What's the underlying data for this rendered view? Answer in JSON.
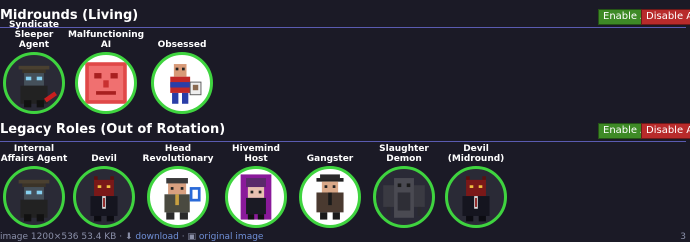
{
  "midrounds": {
    "title": "Midrounds (Living)",
    "enable_label": "Enable All",
    "disable_label": "Disable All",
    "roles": [
      {
        "label": "Syndicate\nSleeper Agent",
        "icon": "sleeper-agent-icon"
      },
      {
        "label": "Malfunctioning\nAI",
        "icon": "malf-ai-icon"
      },
      {
        "label": "Obsessed",
        "icon": "obsessed-icon"
      }
    ]
  },
  "legacy": {
    "title": "Legacy Roles (Out of Rotation)",
    "enable_label": "Enable All",
    "disable_label": "Disable All",
    "roles": [
      {
        "label": "Internal\nAffairs Agent",
        "icon": "internal-affairs-icon"
      },
      {
        "label": "Devil",
        "icon": "devil-icon"
      },
      {
        "label": "Head\nRevolutionary",
        "icon": "head-revolutionary-icon"
      },
      {
        "label": "Hivemind Host",
        "icon": "hivemind-host-icon"
      },
      {
        "label": "Gangster",
        "icon": "gangster-icon"
      },
      {
        "label": "Slaughter\nDemon",
        "icon": "slaughter-demon-icon"
      },
      {
        "label": "Devil\n(Midround)",
        "icon": "devil-midround-icon"
      }
    ]
  },
  "footer": {
    "text_prefix": "image 1200×536 53.4 KB ·",
    "download_label": "download",
    "separator": "·",
    "original_label": "original image",
    "page_number": "3"
  },
  "colors": {
    "background": "#1b1a26",
    "enable": "#3e8a26",
    "disable": "#b82b2b",
    "ring": "#3fd43f",
    "divider": "#5a5bb0"
  }
}
